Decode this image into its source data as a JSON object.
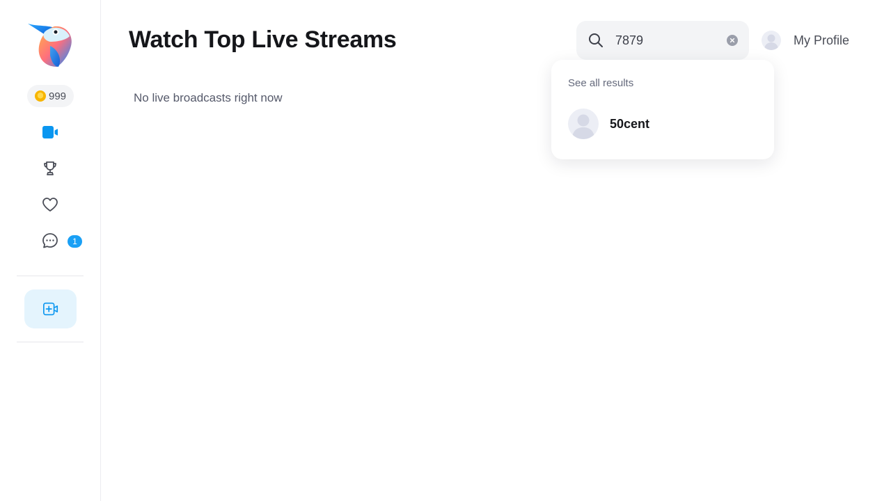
{
  "sidebar": {
    "coins": "999",
    "messages_badge": "1",
    "nav": [
      {
        "icon": "video-camera-icon",
        "active": true
      },
      {
        "icon": "trophy-icon"
      },
      {
        "icon": "heart-icon"
      },
      {
        "icon": "chat-bubble-icon"
      }
    ],
    "go_live_icon": "video-add-icon"
  },
  "main": {
    "title": "Watch Top Live Streams",
    "empty_message": "No live broadcasts right now"
  },
  "search": {
    "value": "7879",
    "results_header": "See all results",
    "results": [
      {
        "name": "50cent"
      }
    ]
  },
  "profile": {
    "label": "My Profile"
  },
  "colors": {
    "accent": "#1aa0f5",
    "active_icon": "#0a96f0",
    "go_live_bg": "#e4f4fd"
  }
}
